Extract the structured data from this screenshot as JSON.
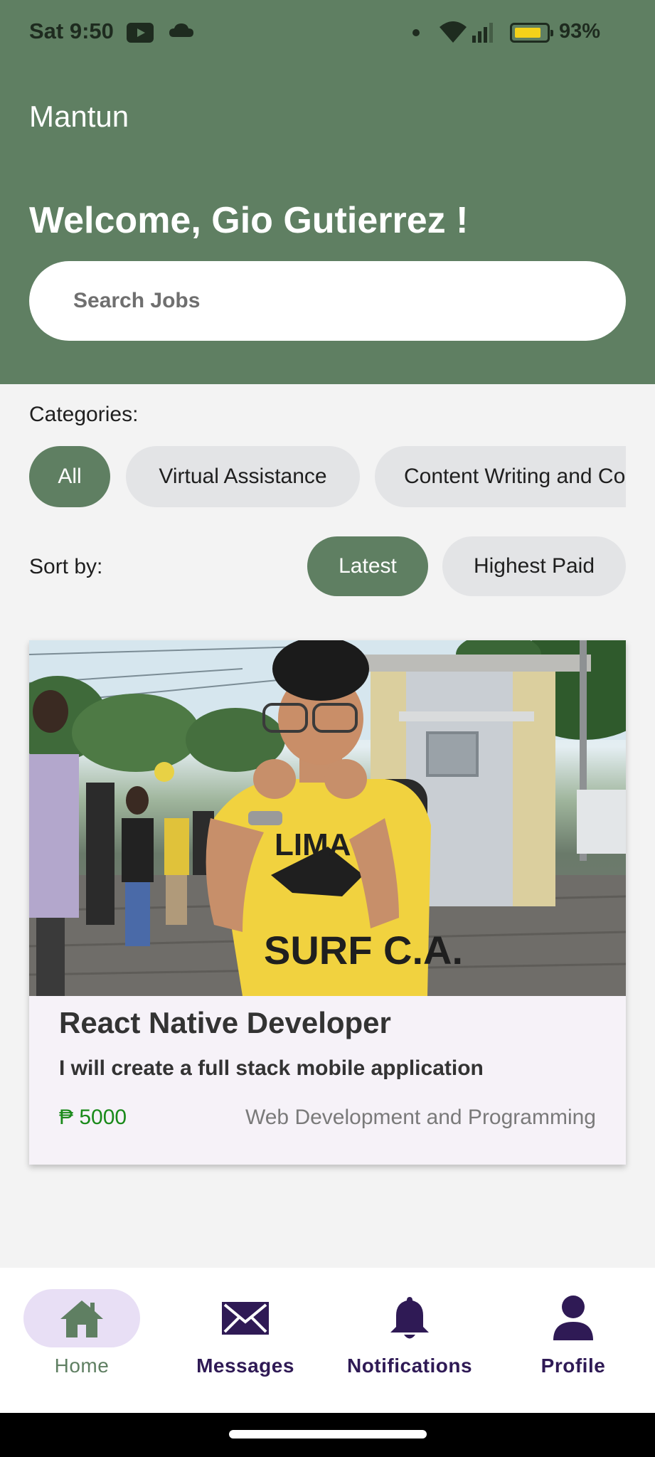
{
  "status_bar": {
    "time": "Sat 9:50",
    "battery": "93%"
  },
  "header": {
    "app_title": "Mantun",
    "welcome": "Welcome, Gio Gutierrez !",
    "search_placeholder": "Search Jobs"
  },
  "categories": {
    "label": "Categories:",
    "items": [
      "All",
      "Virtual Assistance",
      "Content Writing and Co"
    ],
    "selected": "All"
  },
  "sort": {
    "label": "Sort by:",
    "options": [
      "Latest",
      "Highest Paid"
    ],
    "selected": "Latest"
  },
  "job_card": {
    "title": "React Native Developer",
    "subtitle": "I will create a full stack mobile application",
    "price": "₱ 5000",
    "category": "Web Development and Programming",
    "shirt_text_1": "LIMA",
    "shirt_text_2": "SURF C.A."
  },
  "bottom_nav": {
    "items": [
      {
        "label": "Home",
        "icon": "home-icon"
      },
      {
        "label": "Messages",
        "icon": "envelope-icon"
      },
      {
        "label": "Notifications",
        "icon": "bell-icon"
      },
      {
        "label": "Profile",
        "icon": "person-icon"
      }
    ],
    "active": "Home"
  },
  "colors": {
    "header_green": "#5f7f62",
    "nav_purple": "#2f1a55",
    "active_pill": "#e8dff5",
    "price_green": "#1a8a1a"
  }
}
